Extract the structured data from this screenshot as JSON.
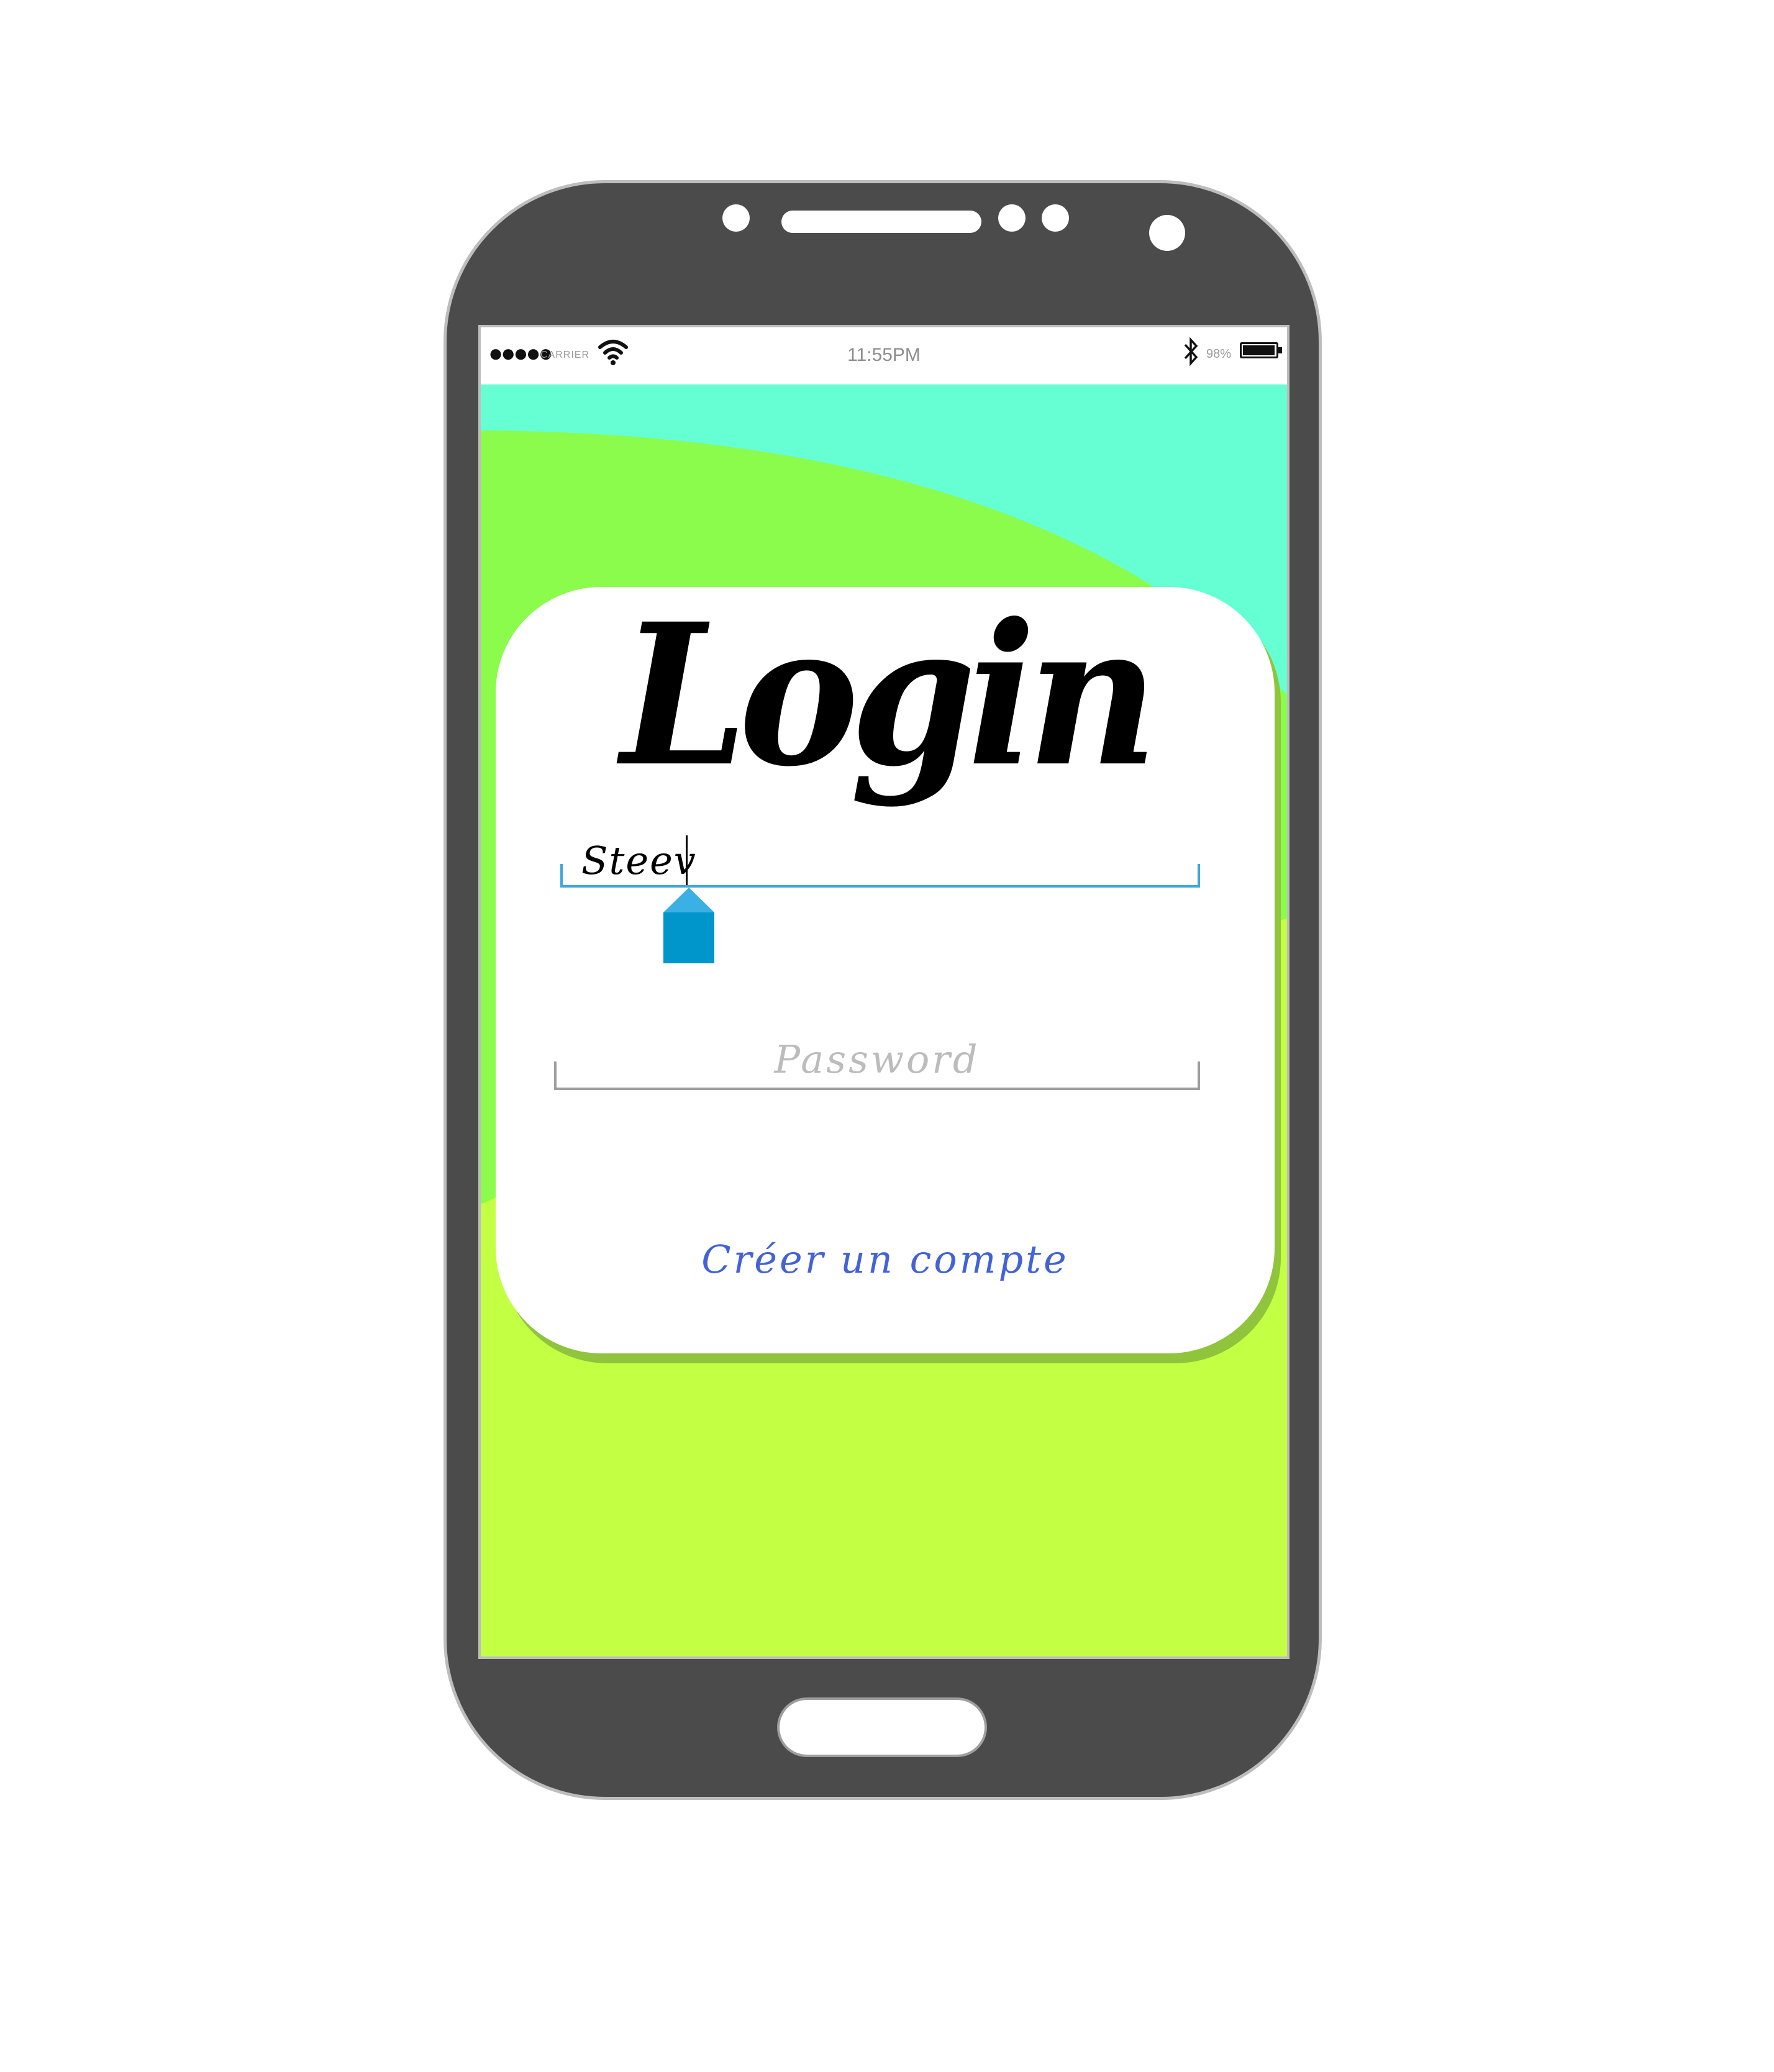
{
  "status_bar": {
    "signal": "●●●●●",
    "carrier": "CARRIER",
    "time": "11:55PM",
    "battery_percent": "98%",
    "battery_level": 0.98,
    "icons": [
      "wifi-icon",
      "bluetooth-icon",
      "battery-icon"
    ]
  },
  "login": {
    "title": "Login",
    "username_value": "Steev",
    "password_placeholder": "Password",
    "create_account_label": "Créer un compte"
  },
  "colors": {
    "phone_body": "#4b4b4b",
    "background_top": "#66ffd4",
    "background_mid": "#8bfb4c",
    "background_bottom": "#c3ff42",
    "focus_accent": "#40a6dd",
    "link": "#4462d8"
  }
}
